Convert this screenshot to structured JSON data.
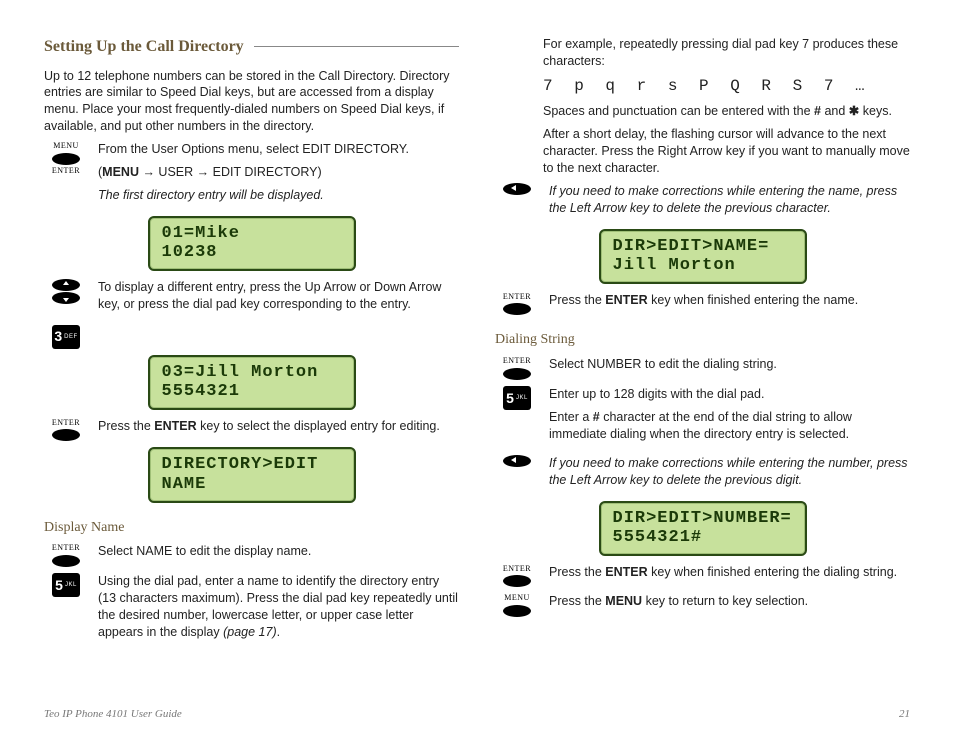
{
  "section_title": "Setting Up the Call Directory",
  "intro": "Up to 12 telephone numbers can be stored in the Call Directory. Directory entries are similar to Speed Dial keys, but are accessed from a display menu. Place your most frequently-dialed numbers on Speed Dial keys, if available, and put other numbers in the directory.",
  "labels": {
    "menu": "MENU",
    "enter": "ENTER"
  },
  "keys": {
    "k3": {
      "digit": "3",
      "letters": "DEF"
    },
    "k5": {
      "digit": "5",
      "letters": "JKL"
    }
  },
  "left": {
    "step1a": "From the User Options menu, select EDIT DIRECTORY.",
    "step1b_prefix": "(",
    "step1b_menu": "MENU",
    "step1b_mid": " → USER → EDIT DIRECTORY)",
    "step1c": "The first directory entry will be displayed.",
    "step2": "To display a different entry, press the Up Arrow or Down Arrow key, or press the dial pad key corresponding to the entry.",
    "step3a": "Press the ",
    "step3b": "ENTER",
    "step3c": " key to select the displayed entry for editing.",
    "sub_display_name": "Display Name",
    "dn_step1": "Select NAME to edit the display name.",
    "dn_step2a": "Using the dial pad, enter a name to identify the directory entry (13 characters maximum). Press the dial pad key repeatedly until the desired number, lowercase letter, or upper case letter appears in the display ",
    "dn_step2b": "(page 17)",
    "dn_step2c": "."
  },
  "right": {
    "para1": "For example, repeatedly pressing dial pad key 7 produces these characters:",
    "char_seq": "7 p q r s P Q R S 7 …",
    "para2a": "Spaces and punctuation can be entered with the ",
    "para2b": "#",
    "para2c": " and ",
    "para2d": "✱",
    "para2e": " keys.",
    "para3": "After a short delay, the flashing cursor will advance to the next character. Press the Right Arrow key if you want to manually move to the next character.",
    "leftarrow_note": "If you need to make corrections while entering the name, press the Left Arrow key to delete the previous character.",
    "enter_name_a": "Press the ",
    "enter_name_b": "ENTER",
    "enter_name_c": " key when finished entering the name.",
    "sub_dialing": "Dialing String",
    "ds_step1": "Select NUMBER to edit the dialing string.",
    "ds_step2a": "Enter up to 128 digits with the dial pad.",
    "ds_step2b_a": "Enter a ",
    "ds_step2b_b": "#",
    "ds_step2b_c": " character at the end of the dial string to allow immediate dialing when the directory entry is selected.",
    "ds_leftnote": "If you need to make corrections while entering the number, press the Left Arrow key to delete the previous digit.",
    "ds_enter_a": "Press the ",
    "ds_enter_b": "ENTER",
    "ds_enter_c": " key when finished entering the dialing string.",
    "ds_menu_a": "Press the ",
    "ds_menu_b": "MENU",
    "ds_menu_c": " key to return to key selection."
  },
  "lcd": {
    "s1l1": "01=Mike",
    "s1l2": "10238",
    "s2l1": "03=Jill Morton",
    "s2l2": "5554321",
    "s3l1": "DIRECTORY>EDIT",
    "s3l2": "NAME",
    "s4l1": "DIR>EDIT>NAME=",
    "s4l2": "Jill Morton",
    "s5l1": "DIR>EDIT>NUMBER=",
    "s5l2": "5554321#"
  },
  "footer": {
    "left": "Teo IP Phone 4101 User Guide",
    "right": "21"
  }
}
